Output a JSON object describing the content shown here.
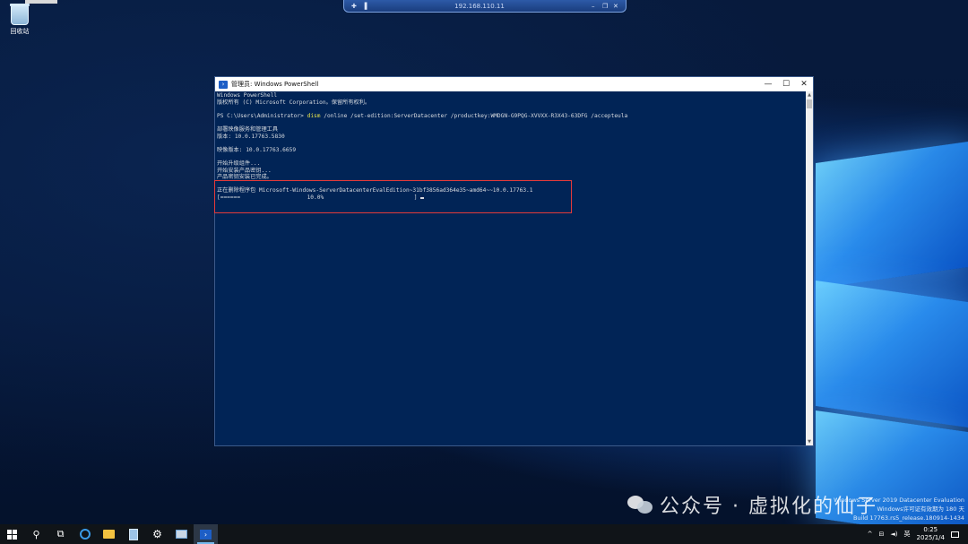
{
  "remote_bar": {
    "host": "192.168.110.11",
    "pin_icon": "pin-icon",
    "signal_icon": "signal-icon",
    "minimize_icon": "minimize-icon",
    "restore_icon": "restore-icon",
    "close_icon": "close-icon"
  },
  "desktop": {
    "recycle_bin_label": "回收站"
  },
  "window": {
    "title": "管理员: Windows PowerShell",
    "minimize_glyph": "—",
    "maximize_glyph": "☐",
    "close_glyph": "✕",
    "lines": [
      {
        "text": "Windows PowerShell"
      },
      {
        "text": "版权所有 (C) Microsoft Corporation。保留所有权利。"
      },
      {
        "text": ""
      },
      {
        "prompt": "PS C:\\Users\\Administrator> ",
        "cmd": "dism",
        "args": " /online /set-edition:ServerDatacenter /productkey:WMDGN-G9PQG-XVVXX-R3X43-63DFG /accepteula"
      },
      {
        "text": ""
      },
      {
        "text": "部署映像服务和管理工具"
      },
      {
        "text": "版本: 10.0.17763.5830"
      },
      {
        "text": ""
      },
      {
        "text": "映像版本: 10.0.17763.6659"
      },
      {
        "text": ""
      },
      {
        "text": "开始升级组件..."
      },
      {
        "text": "开始安装产品密钥..."
      },
      {
        "text": "产品密钥安装已完成。"
      },
      {
        "text": ""
      },
      {
        "text": "正在删除程序包 Microsoft-Windows-ServerDatacenterEvalEdition~31bf3856ad364e35~amd64~~10.0.17763.1"
      },
      {
        "progress_bar": "[======                    10.0%                           ]"
      }
    ]
  },
  "watermark": {
    "text": "公众号 · 虚拟化的仙子"
  },
  "eval_notice": {
    "line1": "Windows Server 2019 Datacenter Evaluation",
    "line2": "Windows许可证有效期为 180 天",
    "line3": "Build 17763.rs5_release.180914-1434"
  },
  "taskbar": {
    "items": [
      {
        "name": "start-button",
        "icon": "windows-logo-icon"
      },
      {
        "name": "search-button",
        "icon": "search-icon",
        "glyph": "⚲"
      },
      {
        "name": "task-view-button",
        "icon": "task-view-icon",
        "glyph": "⧉"
      },
      {
        "name": "edge-button",
        "icon": "edge-icon"
      },
      {
        "name": "file-explorer-button",
        "icon": "folder-icon"
      },
      {
        "name": "server-manager-button",
        "icon": "server-manager-icon"
      },
      {
        "name": "settings-button",
        "icon": "gear-icon",
        "glyph": "⚙"
      },
      {
        "name": "network-button",
        "icon": "network-icon"
      },
      {
        "name": "powershell-taskbar-button",
        "icon": "powershell-icon",
        "active": true
      }
    ],
    "tray": {
      "up_arrow": "^",
      "network": "⊟",
      "volume": "◄)",
      "ime": "英",
      "time": "0:25",
      "date": "2025/1/4"
    }
  }
}
